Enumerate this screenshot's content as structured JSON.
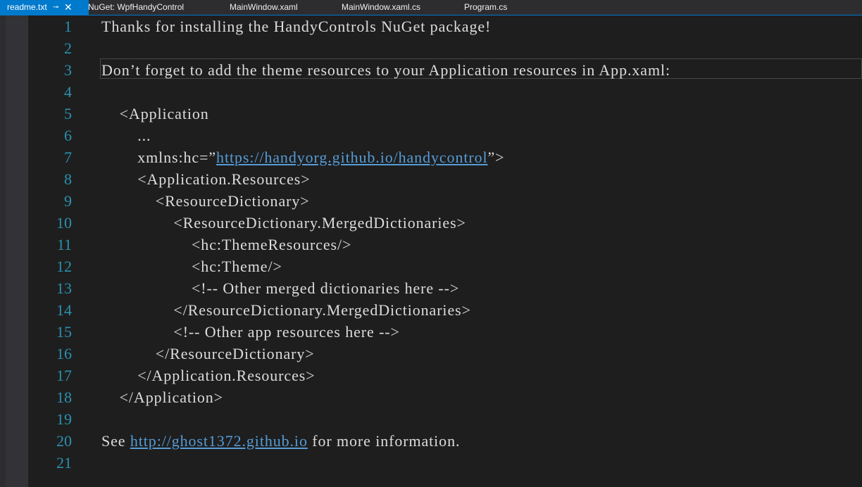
{
  "tabs": [
    {
      "label": "readme.txt",
      "active": true
    },
    {
      "label": "NuGet: WpfHandyControl"
    },
    {
      "label": "MainWindow.xaml"
    },
    {
      "label": "MainWindow.xaml.cs"
    },
    {
      "label": "Program.cs"
    }
  ],
  "tab_icons": {
    "pin": "⊸",
    "close": "✕"
  },
  "editor": {
    "lines": [
      {
        "num": "1",
        "text": "Thanks for installing the HandyControls NuGet package!"
      },
      {
        "num": "2",
        "text": ""
      },
      {
        "num": "3",
        "text": "Don’t forget to add the theme resources to your Application resources in App.xaml:"
      },
      {
        "num": "4",
        "text": ""
      },
      {
        "num": "5",
        "text": "    <Application"
      },
      {
        "num": "6",
        "text": "        ..."
      },
      {
        "num": "7",
        "prefix": "        xmlns:hc=”",
        "link": "https://handyorg.github.io/handycontrol",
        "suffix": "”>"
      },
      {
        "num": "8",
        "text": "        <Application.Resources>"
      },
      {
        "num": "9",
        "text": "            <ResourceDictionary>"
      },
      {
        "num": "10",
        "text": "                <ResourceDictionary.MergedDictionaries>"
      },
      {
        "num": "11",
        "text": "                    <hc:ThemeResources/>"
      },
      {
        "num": "12",
        "text": "                    <hc:Theme/>"
      },
      {
        "num": "13",
        "text": "                    <!-- Other merged dictionaries here -->"
      },
      {
        "num": "14",
        "text": "                </ResourceDictionary.MergedDictionaries>"
      },
      {
        "num": "15",
        "text": "                <!-- Other app resources here -->"
      },
      {
        "num": "16",
        "text": "            </ResourceDictionary>"
      },
      {
        "num": "17",
        "text": "        </Application.Resources>"
      },
      {
        "num": "18",
        "text": "    </Application>"
      },
      {
        "num": "19",
        "text": ""
      },
      {
        "num": "20",
        "prefix": "See ",
        "link": "http://ghost1372.github.io",
        "suffix": " for more information."
      },
      {
        "num": "21",
        "text": ""
      }
    ]
  },
  "colors": {
    "accent": "#007acc",
    "background": "#1e1e1e",
    "line_number": "#2b91af",
    "text": "#dcdcdc",
    "link": "#569cd6"
  }
}
